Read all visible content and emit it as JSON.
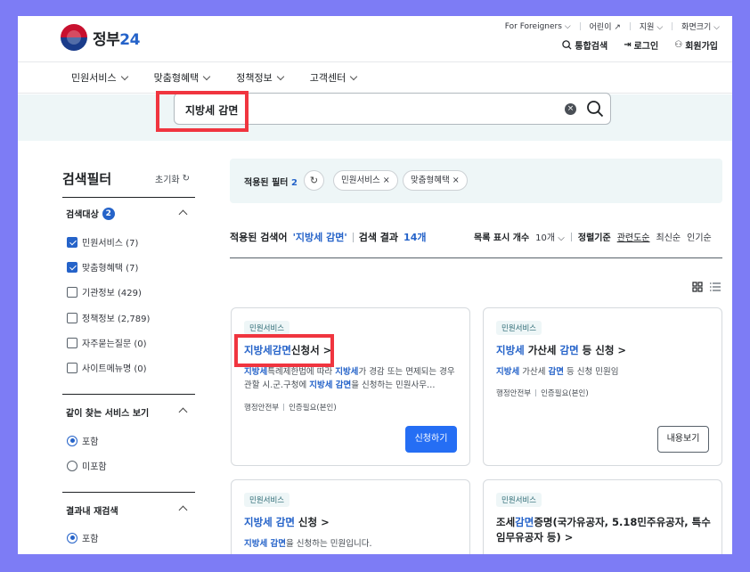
{
  "header": {
    "logo_text": "정부",
    "logo_num": "24",
    "utility": [
      "For Foreigners",
      "어린이",
      "지원",
      "화면크기"
    ],
    "links": {
      "search": "통합검색",
      "login": "로그인",
      "signup": "회원가입"
    }
  },
  "gnb": [
    "민원서비스",
    "맞춤형혜택",
    "정책정보",
    "고객센터"
  ],
  "search": {
    "value": "지방세 감면",
    "clear": "×"
  },
  "filter": {
    "title": "검색필터",
    "reset": "초기화",
    "target_label": "검색대상",
    "target_count": "2",
    "targets": [
      {
        "label": "민원서비스 (7)",
        "checked": true
      },
      {
        "label": "맞춤형혜택 (7)",
        "checked": true
      },
      {
        "label": "기관정보 (429)",
        "checked": false
      },
      {
        "label": "정책정보 (2,789)",
        "checked": false
      },
      {
        "label": "자주묻는질문 (0)",
        "checked": false
      },
      {
        "label": "사이트메뉴명 (0)",
        "checked": false
      }
    ],
    "related_label": "같이 찾는 서비스 보기",
    "related_opts": [
      "포함",
      "미포함"
    ],
    "research_label": "결과내 재검색",
    "research_opts": [
      "포함"
    ]
  },
  "applied": {
    "label": "적용된 필터",
    "count": "2",
    "chips": [
      "민원서비스 ×",
      "맞춤형혜택 ×"
    ]
  },
  "results": {
    "prefix": "적용된 검색어",
    "query": "'지방세 감면'",
    "count_label": "검색 결과",
    "count": "14개",
    "list_count_label": "목록 표시 개수",
    "list_count": "10개",
    "sort_label": "정렬기준",
    "sorts": [
      "관련도순",
      "최신순",
      "인기순"
    ]
  },
  "cards": [
    {
      "tag": "민원서비스",
      "title_k": "지방세감면",
      "title_rest": "신청서 >",
      "desc": [
        "지방세",
        "특례제한법에 따라 ",
        "지방세",
        "가 경감 또는 면제되는 경우 관할 시.군.구청에 ",
        "지방세 감면",
        "을 신청하는 민원사무…"
      ],
      "meta": [
        "행정안전부",
        "인증필요(본인)"
      ],
      "button": "신청하기"
    },
    {
      "tag": "민원서비스",
      "title_parts": [
        "지방세",
        " 가산세 ",
        "감면",
        " 등 신청 >"
      ],
      "desc": [
        "지방세",
        " 가산세 ",
        "감면",
        " 등 신청 민원임"
      ],
      "meta": [
        "행정안전부",
        "인증필요(본인)"
      ],
      "button": "내용보기"
    },
    {
      "tag": "민원서비스",
      "title_parts": [
        "지방세 감면",
        " 신청 >"
      ],
      "desc": [
        "지방세 감면",
        "을 신청하는 민원입니다."
      ]
    },
    {
      "tag": "민원서비스",
      "title_parts": [
        "조세",
        "감면",
        "증명(국가유공자, 5.18민주유공자, 특수임무유공자 등) >"
      ]
    }
  ]
}
